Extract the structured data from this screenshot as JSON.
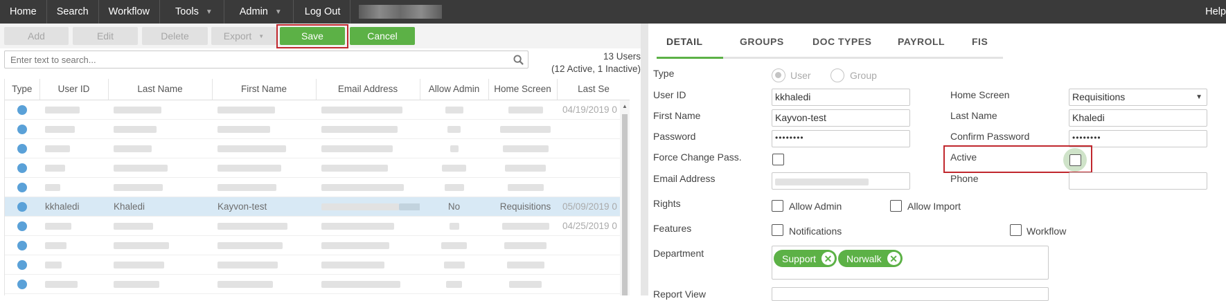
{
  "nav": {
    "items": [
      {
        "label": "Home"
      },
      {
        "label": "Search"
      },
      {
        "label": "Workflow"
      },
      {
        "label": "Tools",
        "dropdown": true
      },
      {
        "label": "Admin",
        "dropdown": true
      },
      {
        "label": "Log Out"
      }
    ],
    "help": "Help"
  },
  "toolbar": {
    "add": "Add",
    "edit": "Edit",
    "delete": "Delete",
    "export": "Export",
    "save": "Save",
    "cancel": "Cancel"
  },
  "search": {
    "placeholder": "Enter text to search..."
  },
  "counts": {
    "total": "13 Users",
    "detail": "(12 Active, 1 Inactive)"
  },
  "grid": {
    "columns": [
      "Type",
      "User ID",
      "Last Name",
      "First Name",
      "Email Address",
      "Allow Admin",
      "Home Screen",
      "Last Se"
    ],
    "rows": [
      {
        "type": "user",
        "user_id": "",
        "last_name": "",
        "first_name": "",
        "email": "",
        "allow_admin": "",
        "home_screen": "",
        "last_seen": "04/19/2019 0"
      },
      {
        "type": "user",
        "user_id": "",
        "last_name": "",
        "first_name": "",
        "email": "",
        "allow_admin": "",
        "home_screen": "",
        "last_seen": ""
      },
      {
        "type": "group",
        "user_id": "",
        "last_name": "",
        "first_name": "",
        "email": "",
        "allow_admin": "",
        "home_screen": "",
        "last_seen": ""
      },
      {
        "type": "group",
        "user_id": "",
        "last_name": "",
        "first_name": "",
        "email": "",
        "allow_admin": "",
        "home_screen": "",
        "last_seen": ""
      },
      {
        "type": "user",
        "user_id": "",
        "last_name": "",
        "first_name": "",
        "email": "",
        "allow_admin": "",
        "home_screen": "",
        "last_seen": ""
      },
      {
        "type": "user",
        "user_id": "kkhaledi",
        "last_name": "Khaledi",
        "first_name": "Kayvon-test",
        "email": "",
        "allow_admin": "No",
        "home_screen": "Requisitions",
        "last_seen": "05/09/2019 0",
        "selected": true
      },
      {
        "type": "user",
        "user_id": "",
        "last_name": "",
        "first_name": "",
        "email": "",
        "allow_admin": "",
        "home_screen": "",
        "last_seen": "04/25/2019 0"
      },
      {
        "type": "user",
        "user_id": "",
        "last_name": "",
        "first_name": "",
        "email": "",
        "allow_admin": "",
        "home_screen": "",
        "last_seen": ""
      },
      {
        "type": "group",
        "user_id": "",
        "last_name": "",
        "first_name": "",
        "email": "",
        "allow_admin": "",
        "home_screen": "",
        "last_seen": ""
      },
      {
        "type": "group",
        "user_id": "",
        "last_name": "",
        "first_name": "",
        "email": "",
        "allow_admin": "",
        "home_screen": "",
        "last_seen": ""
      },
      {
        "type": "user",
        "user_id": "",
        "last_name": "",
        "first_name": "",
        "email": "",
        "allow_admin": "",
        "home_screen": "",
        "last_seen": ""
      }
    ]
  },
  "tabs": [
    "DETAIL",
    "GROUPS",
    "DOC TYPES",
    "PAYROLL",
    "FIS"
  ],
  "detail": {
    "type_label": "Type",
    "type_user": "User",
    "type_group": "Group",
    "user_id_label": "User ID",
    "user_id": "kkhaledi",
    "home_screen_label": "Home Screen",
    "home_screen": "Requisitions",
    "first_name_label": "First Name",
    "first_name": "Kayvon-test",
    "last_name_label": "Last Name",
    "last_name": "Khaledi",
    "password_label": "Password",
    "password": "••••••••",
    "confirm_password_label": "Confirm Password",
    "confirm_password": "••••••••",
    "force_change_label": "Force Change Pass.",
    "active_label": "Active",
    "email_label": "Email Address",
    "email": "",
    "phone_label": "Phone",
    "phone": "",
    "rights_label": "Rights",
    "allow_admin_label": "Allow Admin",
    "allow_import_label": "Allow Import",
    "features_label": "Features",
    "notifications_label": "Notifications",
    "workflow_label": "Workflow",
    "department_label": "Department",
    "departments": [
      "Support",
      "Norwalk"
    ],
    "report_view_label": "Report View"
  },
  "colors": {
    "accent": "#5cb146",
    "highlight": "#c0272d",
    "nav": "#3a3a3a",
    "selected_row": "#d8e9f5"
  }
}
